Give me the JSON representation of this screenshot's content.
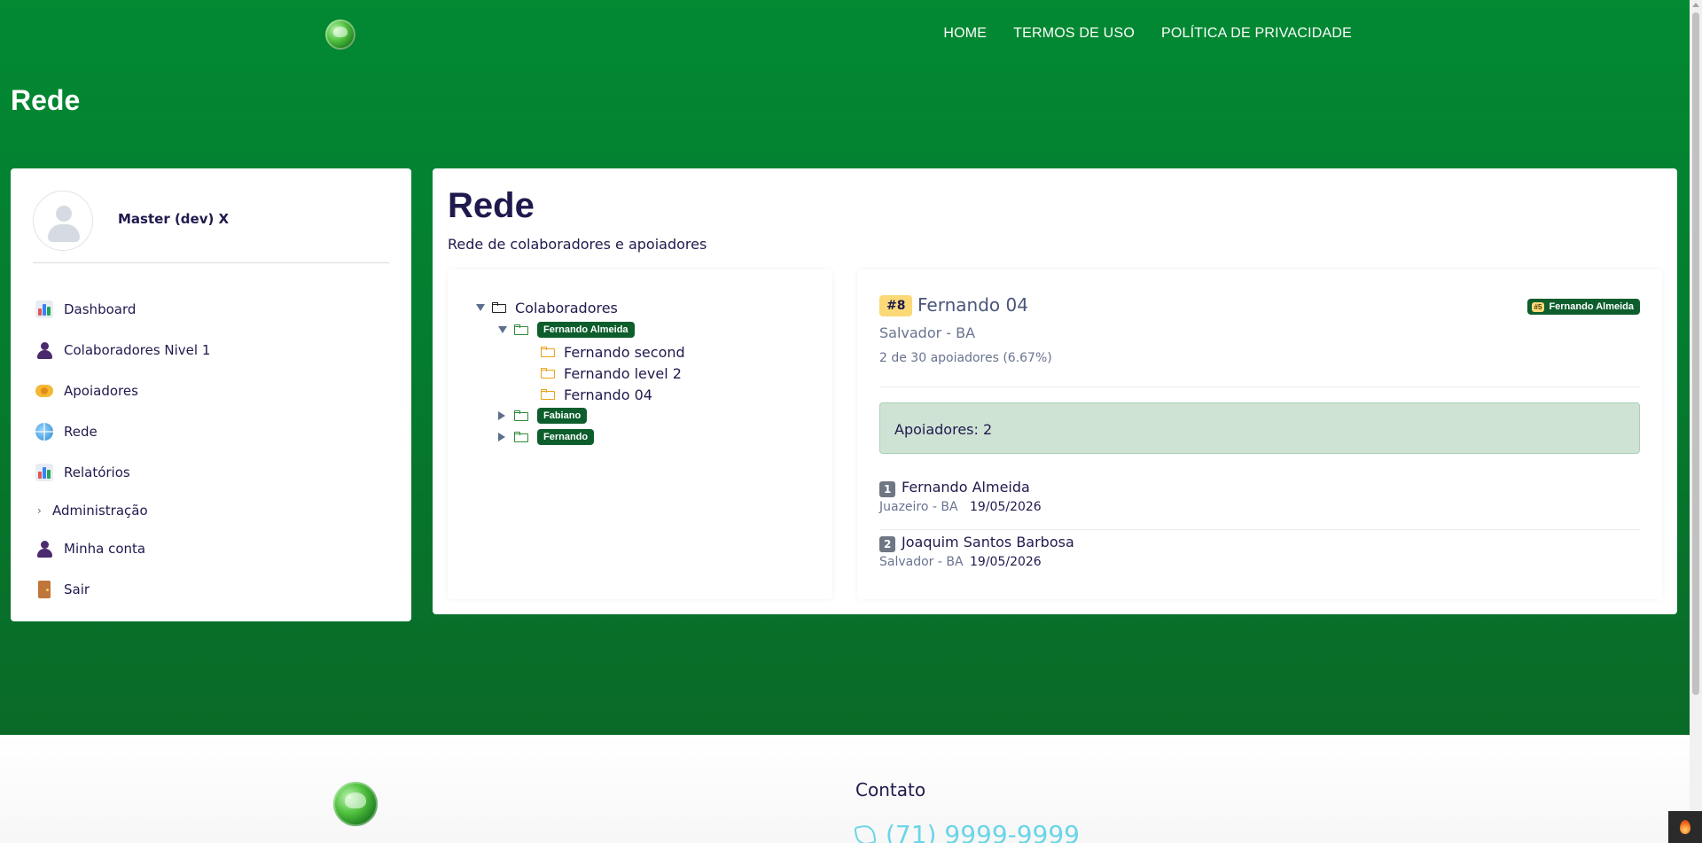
{
  "header": {
    "nav": [
      {
        "label": "HOME"
      },
      {
        "label": "TERMOS DE USO"
      },
      {
        "label": "POLÍTICA DE PRIVACIDADE"
      }
    ],
    "page_title": "Rede"
  },
  "sidebar": {
    "user_name": "Master (dev) X",
    "items": [
      {
        "label": "Dashboard",
        "icon": "bar-chart-icon"
      },
      {
        "label": "Colaboradores Nivel 1",
        "icon": "person-icon"
      },
      {
        "label": "Apoiadores",
        "icon": "handshake-icon"
      },
      {
        "label": "Rede",
        "icon": "globe-icon"
      },
      {
        "label": "Relatórios",
        "icon": "bar-chart-icon"
      },
      {
        "label": "Administração",
        "icon": "chevron-right-icon"
      },
      {
        "label": "Minha conta",
        "icon": "person-icon"
      },
      {
        "label": "Sair",
        "icon": "door-icon"
      }
    ]
  },
  "main": {
    "title": "Rede",
    "subtitle": "Rede de colaboradores e apoiadores",
    "tree": {
      "root": "Colaboradores",
      "nodes": [
        {
          "label": "Fernando Almeida",
          "expanded": true,
          "children": [
            "Fernando second",
            "Fernando level 2",
            "Fernando 04"
          ]
        },
        {
          "label": "Fabiano",
          "expanded": false
        },
        {
          "label": "Fernando",
          "expanded": false
        }
      ]
    },
    "detail": {
      "rank": "#8",
      "name": "Fernando 04",
      "parent_rank": "#5",
      "parent_name": "Fernando Almeida",
      "location": "Salvador - BA",
      "stats": "2 de 30 apoiadores (6.67%)",
      "supporters_label": "Apoiadores: 2",
      "supporters": [
        {
          "num": "1",
          "name": "Fernando Almeida",
          "location": "Juazeiro - BA",
          "date": "19/05/2026"
        },
        {
          "num": "2",
          "name": "Joaquim Santos Barbosa",
          "location": "Salvador - BA",
          "date": "19/05/2026"
        }
      ]
    }
  },
  "footer": {
    "contact_title": "Contato",
    "phone": "(71) 9999-9999"
  },
  "colors": {
    "primary_green": "#028932",
    "dark_green_badge": "#0d5e2c",
    "rank_yellow": "#fbd976",
    "alert_green": "#cfe3d5",
    "text_navy": "#1f1a4d",
    "phone_cyan": "#6ad5e7"
  }
}
